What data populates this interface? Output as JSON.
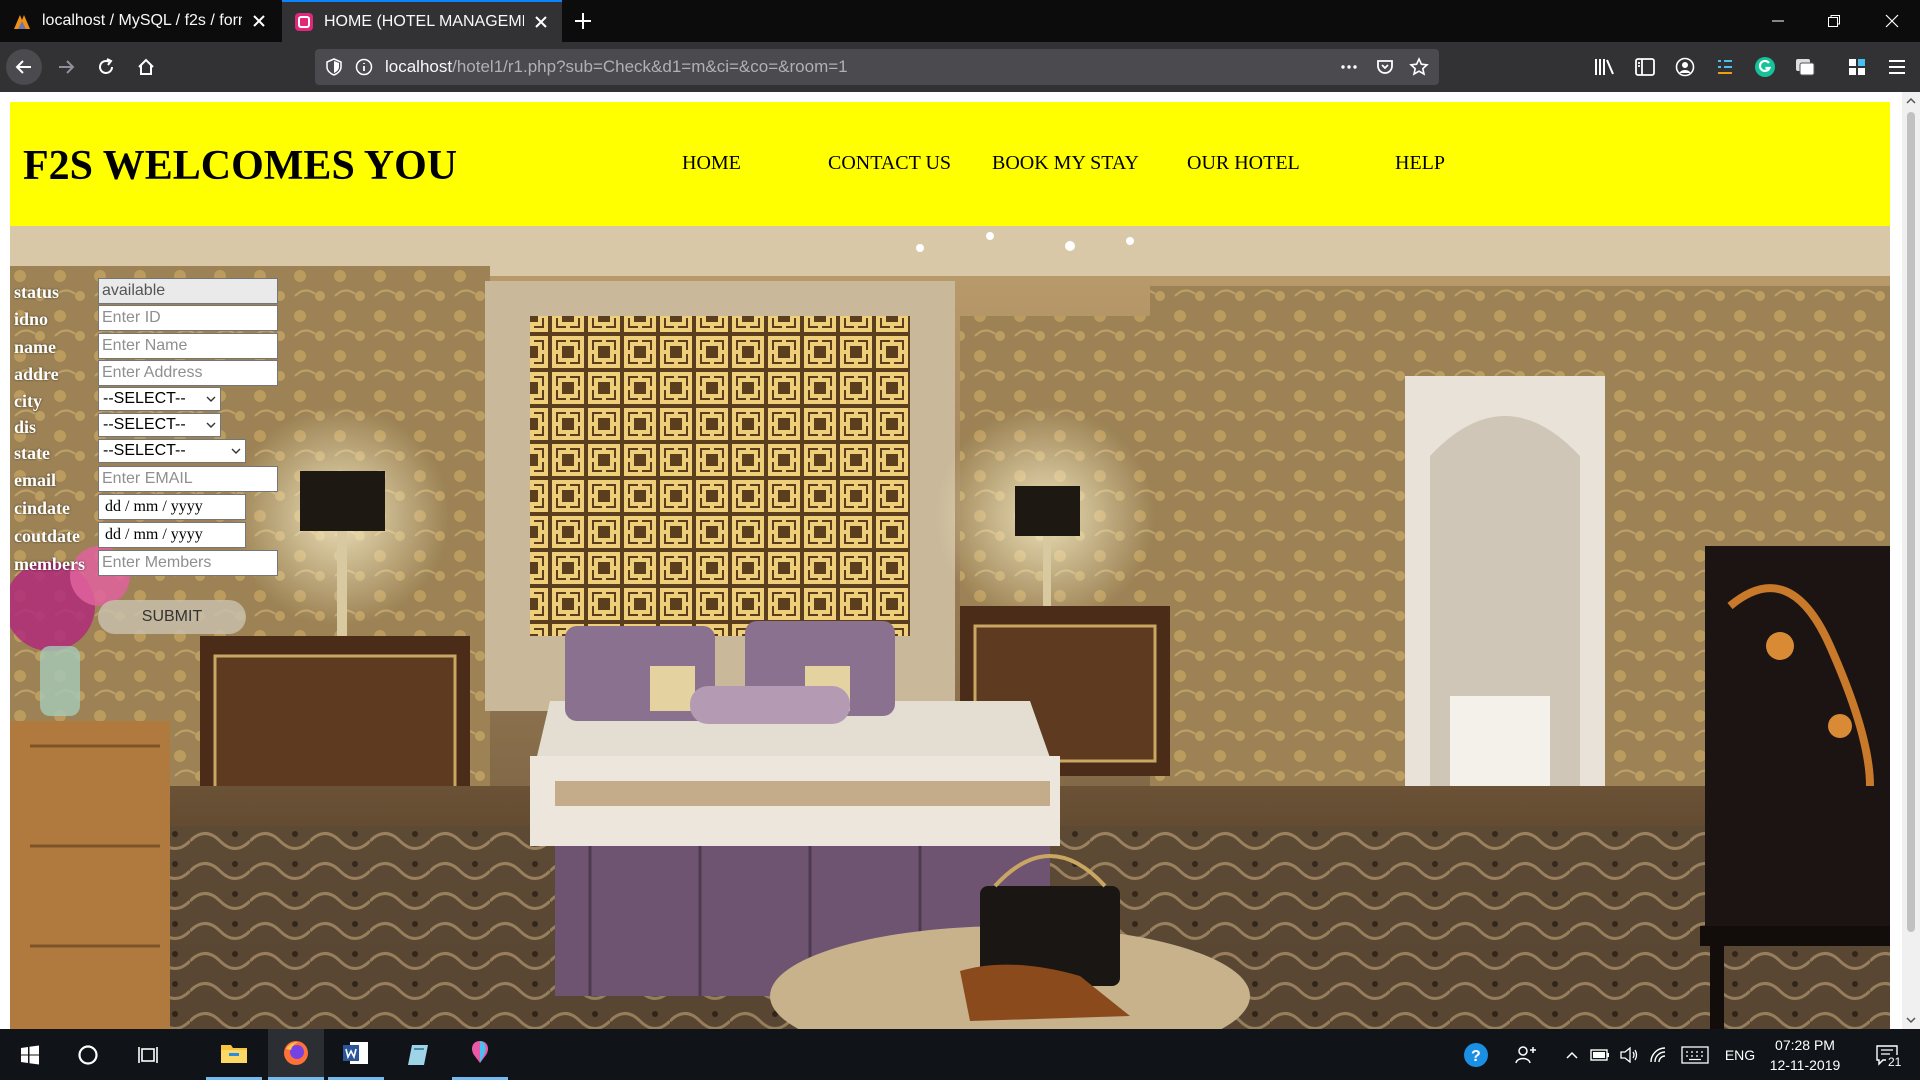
{
  "browser": {
    "tabs": [
      {
        "title": "localhost / MySQL / f2s / form | phpMyAdmin",
        "active": false
      },
      {
        "title": "HOME (HOTEL MANAGEMENT)",
        "active": true
      }
    ],
    "url_host": "localhost",
    "url_path": "/hotel1/r1.php?sub=Check&d1=m&ci=&co=&room=1",
    "accent_color": "#0a84ff"
  },
  "page": {
    "site_title": "F2S WELCOMES YOU",
    "header_color": "#ffff00",
    "menu": [
      "HOME",
      "CONTACT US",
      "BOOK MY STAY",
      "OUR HOTEL",
      "HELP"
    ]
  },
  "form": {
    "labels": {
      "status": "status",
      "idno": "idno",
      "name": "name",
      "addre": "addre",
      "city": "city",
      "dis": "dis",
      "state": "state",
      "email": "email",
      "cindate": "cindate",
      "coutdate": "coutdate",
      "members": "members"
    },
    "status_value": "available",
    "placeholders": {
      "idno": "Enter ID",
      "name": "Enter Name",
      "addre": "Enter Address",
      "email": "Enter EMAIL",
      "members": "Enter Members"
    },
    "select_default": "--SELECT--",
    "date_placeholder": "dd / mm / yyyy",
    "submit_label": "SUBMIT"
  },
  "taskbar": {
    "language": "ENG",
    "time": "07:28 PM",
    "date": "12-11-2019",
    "notification_count": "21"
  }
}
